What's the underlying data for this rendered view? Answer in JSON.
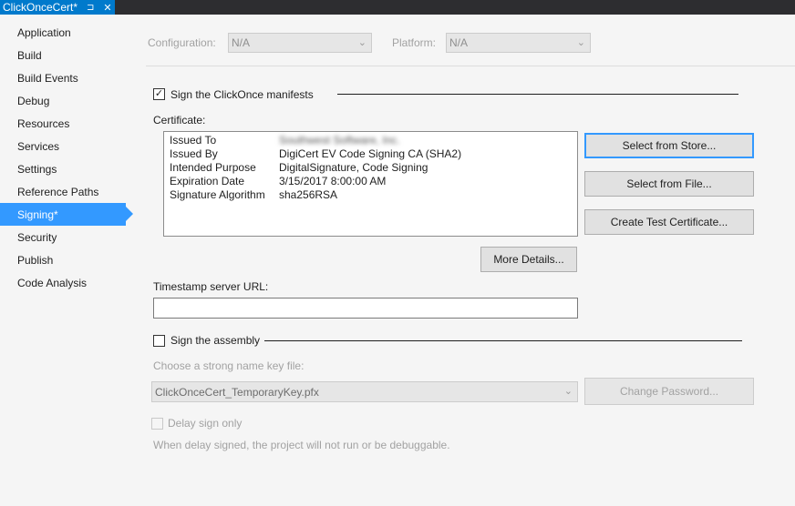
{
  "tab": {
    "title": "ClickOnceCert*",
    "pin_glyph": "⊐",
    "close_glyph": "✕"
  },
  "sidebar": {
    "items": [
      {
        "label": "Application"
      },
      {
        "label": "Build"
      },
      {
        "label": "Build Events"
      },
      {
        "label": "Debug"
      },
      {
        "label": "Resources"
      },
      {
        "label": "Services"
      },
      {
        "label": "Settings"
      },
      {
        "label": "Reference Paths"
      },
      {
        "label": "Signing*",
        "active": true
      },
      {
        "label": "Security"
      },
      {
        "label": "Publish"
      },
      {
        "label": "Code Analysis"
      }
    ]
  },
  "config": {
    "configuration_label": "Configuration:",
    "configuration_value": "N/A",
    "platform_label": "Platform:",
    "platform_value": "N/A"
  },
  "manifests": {
    "checkbox_label": "Sign the ClickOnce manifests",
    "checked": true,
    "check_glyph": "✓",
    "certificate_label": "Certificate:",
    "cert": {
      "rows": [
        {
          "key": "Issued To",
          "value": "Southwest Software, Inc."
        },
        {
          "key": "Issued By",
          "value": "DigiCert EV Code Signing CA (SHA2)"
        },
        {
          "key": "Intended Purpose",
          "value": "DigitalSignature, Code Signing"
        },
        {
          "key": "Expiration Date",
          "value": "3/15/2017 8:00:00 AM"
        },
        {
          "key": "Signature Algorithm",
          "value": "sha256RSA"
        }
      ]
    },
    "buttons": {
      "select_store": "Select from Store...",
      "select_file": "Select from File...",
      "create_test": "Create Test Certificate...",
      "more_details": "More Details..."
    },
    "timestamp_label": "Timestamp server URL:",
    "timestamp_value": ""
  },
  "assembly": {
    "checkbox_label": "Sign the assembly",
    "checked": false,
    "key_file_label": "Choose a strong name key file:",
    "key_file_value": "ClickOnceCert_TemporaryKey.pfx",
    "change_password": "Change Password...",
    "delay_sign_label": "Delay sign only",
    "delay_note": "When delay signed, the project will not run or be debuggable."
  },
  "icons": {
    "chevron": "chevron-down-icon",
    "pin": "pin-icon",
    "close": "close-icon",
    "check": "checkmark-icon"
  },
  "colors": {
    "accent": "#007acc",
    "selection": "#3399ff",
    "tabbar": "#2d2d30",
    "background": "#f5f5f5"
  }
}
